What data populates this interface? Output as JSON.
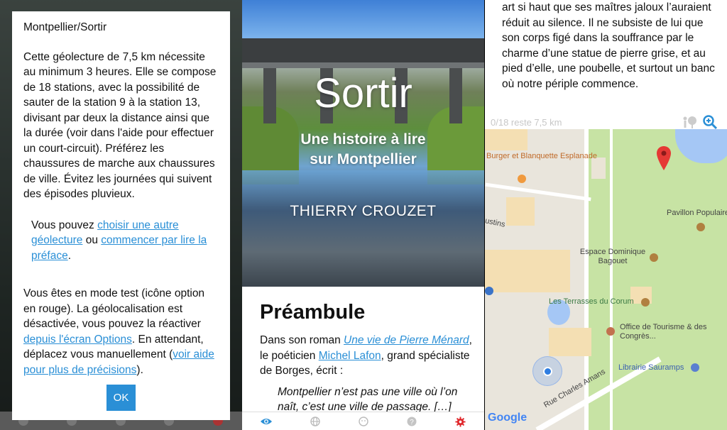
{
  "panel1": {
    "dialog_title": "Montpellier/Sortir",
    "intro_text": "Cette géolecture de 7,5 km nécessite au minimum 3 heures. Elle se compose de 18 stations, avec la possibilité de sauter de la station 9 à la station 13, divisant par deux la distance ainsi que la durée (voir dans l'aide pour effectuer un court-circuit). Préférez les chaussures de marche aux chaussures de ville. Évitez les journées qui suivent des épisodes pluvieux.",
    "choice_prefix": "Vous pouvez ",
    "choice_link1": "choisir une autre géolecture",
    "choice_middle": " ou ",
    "choice_link2": "commencer par lire la préface",
    "choice_suffix": ".",
    "test_prefix": "Vous êtes en mode test (icône option en rouge). La géolocalisation est désactivée, vous pouvez la réactiver ",
    "test_link1": "depuis l'écran Options",
    "test_middle": ". En attendant, déplacez vous manuellement (",
    "test_link2": "voir aide pour plus de précisions",
    "test_suffix": ").",
    "ok_label": "OK"
  },
  "panel2": {
    "cover_title": "Sortir",
    "cover_subtitle_line1": "Une histoire à lire",
    "cover_subtitle_line2": "sur Montpellier",
    "cover_author": "THIERRY CROUZET",
    "heading": "Préambule",
    "para_prefix": "Dans son roman ",
    "para_link1": "Une vie de Pierre Ménard",
    "para_middle": ", le poéticien ",
    "para_link2": "Michel Lafon",
    "para_suffix": ", grand spécialiste de Borges, écrit :",
    "quote": "Montpellier n’est pas une ville où l’on naît, c’est une ville de passage. […]",
    "tabs": [
      "eye-icon",
      "globe-icon",
      "face-icon",
      "help-icon",
      "gear-icon"
    ],
    "active_color": "#2a8fd6",
    "gear_color": "#e0262a"
  },
  "panel3": {
    "story_text": "art si haut que ses maîtres jaloux l’auraient réduit au silence. Il ne subsiste de lui que son corps figé dans la souffrance par le charme d’une statue de pierre grise, et au pied d’elle, une poubelle, et surtout un banc où notre périple commence.",
    "progress_status": "0/18 reste 7,5 km",
    "map": {
      "labels": {
        "burger": "Burger et Blanquette Esplanade",
        "pavillon": "Pavillon Populaire",
        "justins": "ustins",
        "espace": "Espace Dominique Bagouet",
        "corum": "Les Terrasses du Corum",
        "office": "Office de Tourisme & des Congrès...",
        "sauramps": "Librairie Sauramps",
        "rue": "Rue Charles Amans",
        "google": "Google"
      }
    }
  }
}
